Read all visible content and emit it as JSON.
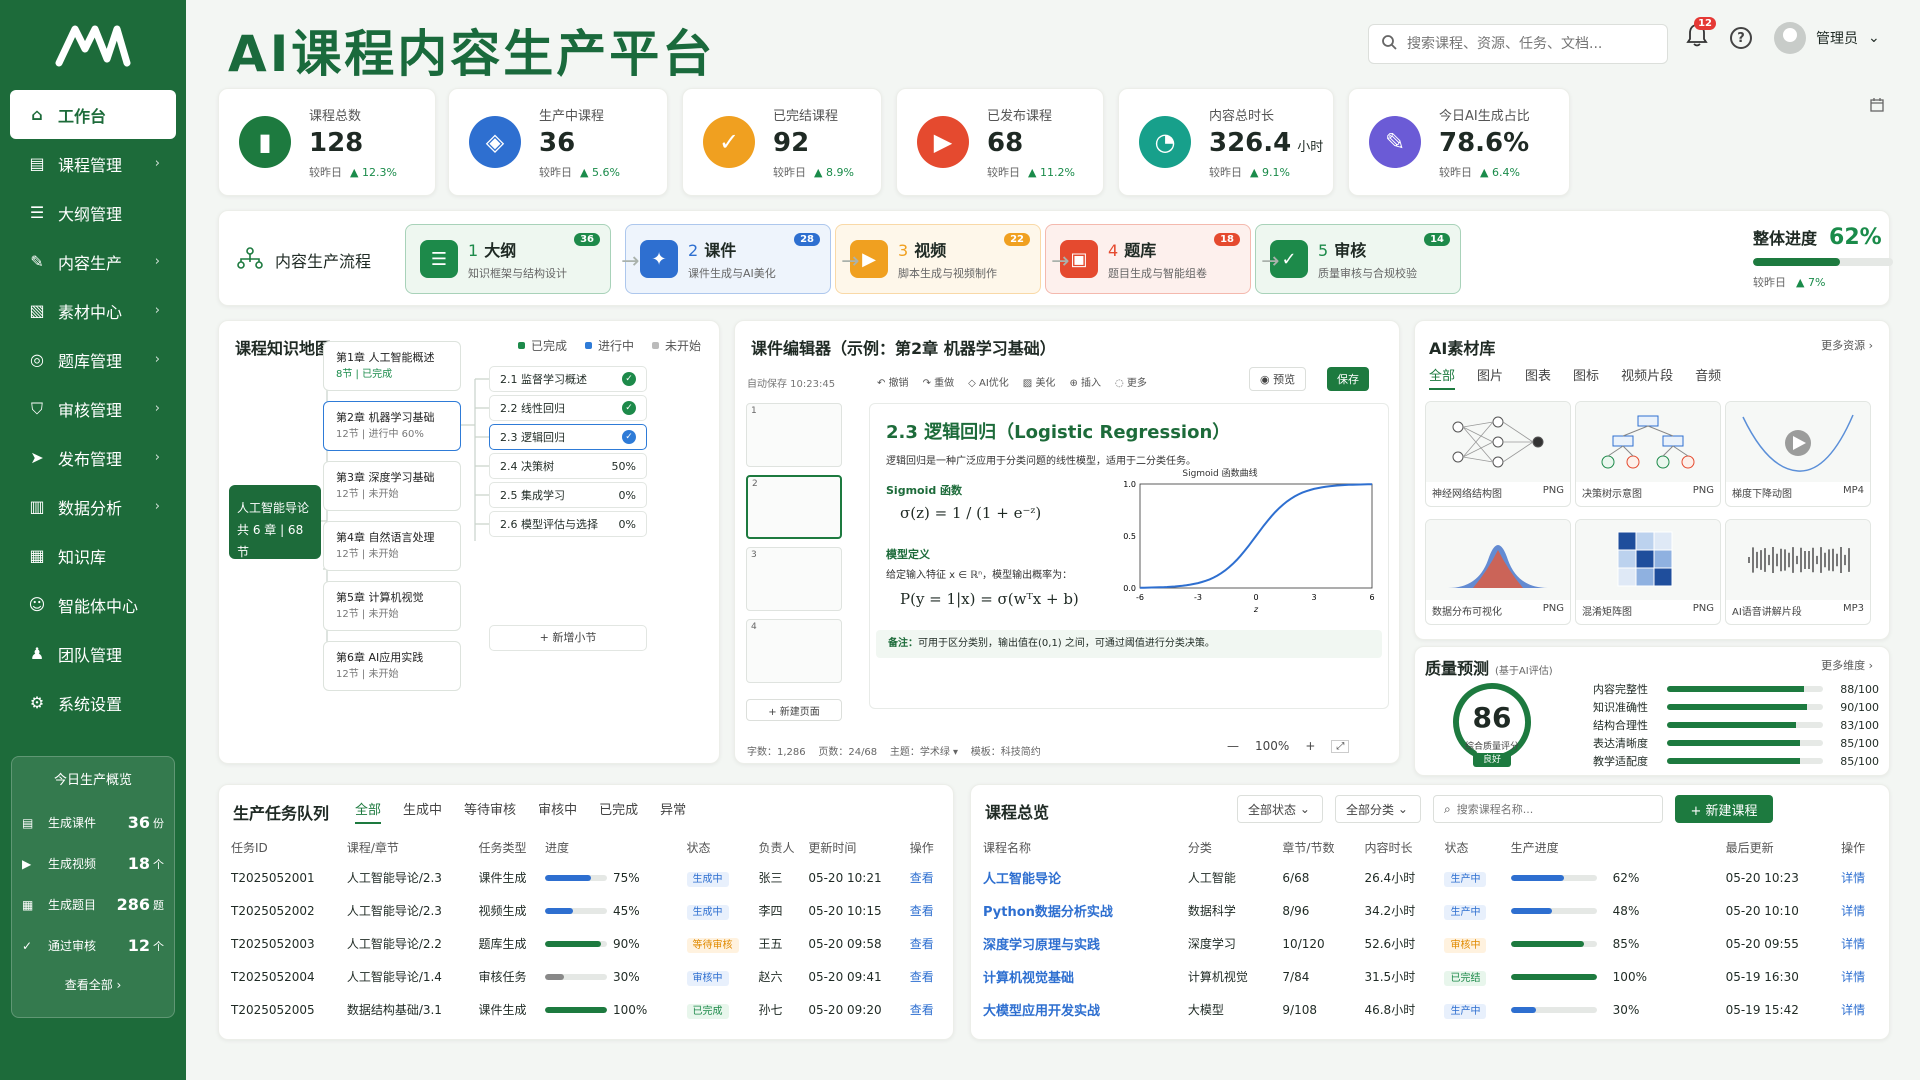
{
  "app": {
    "title": "AI课程内容生产平台",
    "search_placeholder": "搜索课程、资源、任务、文档...",
    "notifications": "12",
    "user": "管理员"
  },
  "sidebar": {
    "items": [
      {
        "label": "工作台",
        "icon": "home-icon"
      },
      {
        "label": "课程管理",
        "icon": "course-icon"
      },
      {
        "label": "大纲管理",
        "icon": "outline-icon"
      },
      {
        "label": "内容生产",
        "icon": "edit-icon"
      },
      {
        "label": "素材中心",
        "icon": "image-icon"
      },
      {
        "label": "题库管理",
        "icon": "quiz-icon"
      },
      {
        "label": "审核管理",
        "icon": "shield-icon"
      },
      {
        "label": "发布管理",
        "icon": "send-icon"
      },
      {
        "label": "数据分析",
        "icon": "chart-icon"
      },
      {
        "label": "知识库",
        "icon": "book-icon"
      },
      {
        "label": "智能体中心",
        "icon": "bot-icon"
      },
      {
        "label": "团队管理",
        "icon": "team-icon"
      },
      {
        "label": "系统设置",
        "icon": "gear-icon"
      }
    ],
    "today": {
      "title": "今日生产概览",
      "rows": [
        {
          "label": "生成课件",
          "value": "36",
          "unit": "份"
        },
        {
          "label": "生成视频",
          "value": "18",
          "unit": "个"
        },
        {
          "label": "生成题目",
          "value": "286",
          "unit": "题"
        },
        {
          "label": "通过审核",
          "value": "12",
          "unit": "个"
        }
      ],
      "more": "查看全部 ›"
    }
  },
  "kpis": [
    {
      "label": "课程总数",
      "value": "128",
      "unit": "",
      "cmp": "较昨日",
      "change": "▲ 12.3%",
      "color": "#1d7a3f"
    },
    {
      "label": "生产中课程",
      "value": "36",
      "unit": "",
      "cmp": "较昨日",
      "change": "▲ 5.6%",
      "color": "#2e6fd0"
    },
    {
      "label": "已完结课程",
      "value": "92",
      "unit": "",
      "cmp": "较昨日",
      "change": "▲ 8.9%",
      "color": "#f0a020"
    },
    {
      "label": "已发布课程",
      "value": "68",
      "unit": "",
      "cmp": "较昨日",
      "change": "▲ 11.2%",
      "color": "#e54a2f"
    },
    {
      "label": "内容总时长",
      "value": "326.4",
      "unit": "小时",
      "cmp": "较昨日",
      "change": "▲ 9.1%",
      "color": "#17a08b"
    },
    {
      "label": "今日AI生成占比",
      "value": "78.6%",
      "unit": "",
      "cmp": "较昨日",
      "change": "▲ 6.4%",
      "color": "#6b5bd6"
    }
  ],
  "flow": {
    "title": "内容生产流程",
    "steps": [
      {
        "num": "1",
        "name": "大纲",
        "desc": "知识框架与结构设计",
        "count": "36",
        "color": "#1d8a4a",
        "bg": "#eef7f0"
      },
      {
        "num": "2",
        "name": "课件",
        "desc": "课件生成与AI美化",
        "count": "28",
        "color": "#2e6fd0",
        "bg": "#eef4fc"
      },
      {
        "num": "3",
        "name": "视频",
        "desc": "脚本生成与视频制作",
        "count": "22",
        "color": "#f0a020",
        "bg": "#fef7ea"
      },
      {
        "num": "4",
        "name": "题库",
        "desc": "题目生成与智能组卷",
        "count": "18",
        "color": "#e54a2f",
        "bg": "#fdf0ed"
      },
      {
        "num": "5",
        "name": "审核",
        "desc": "质量审核与合规校验",
        "count": "14",
        "color": "#1d8a4a",
        "bg": "#eef7f0"
      }
    ],
    "progress_label": "整体进度",
    "progress": "62%",
    "progress_value": 0.62,
    "cmp": "较昨日",
    "change": "▲ 7%"
  },
  "knowledge_map": {
    "title": "课程知识地图",
    "legend": [
      "已完成",
      "进行中",
      "未开始"
    ],
    "root": {
      "name": "人工智能导论",
      "meta": "共 6 章 | 68 节"
    },
    "chapters": [
      {
        "name": "第1章 人工智能概述",
        "meta": "8节 | 已完成"
      },
      {
        "name": "第2章 机器学习基础",
        "meta": "12节 | 进行中 60%"
      },
      {
        "name": "第3章 深度学习基础",
        "meta": "12节 | 未开始"
      },
      {
        "name": "第4章 自然语言处理",
        "meta": "12节 | 未开始"
      },
      {
        "name": "第5章 计算机视觉",
        "meta": "12节 | 未开始"
      },
      {
        "name": "第6章 AI应用实践",
        "meta": "12节 | 未开始"
      }
    ],
    "sections": [
      {
        "name": "2.1 监督学习概述",
        "status": "✓"
      },
      {
        "name": "2.2 线性回归",
        "status": "✓"
      },
      {
        "name": "2.3 逻辑回归",
        "status": "✓"
      },
      {
        "name": "2.4 决策树",
        "status": "50%"
      },
      {
        "name": "2.5 集成学习",
        "status": "0%"
      },
      {
        "name": "2.6 模型评估与选择",
        "status": "0%"
      }
    ],
    "add": "+ 新增小节"
  },
  "editor": {
    "title": "课件编辑器（示例：第2章 机器学习基础）",
    "autosave": "自动保存 10:23:45",
    "tools": [
      "撤销",
      "重做",
      "AI优化",
      "美化",
      "插入",
      "更多"
    ],
    "preview": "预览",
    "save": "保存",
    "slide_title": "2.3 逻辑回归（Logistic Regression）",
    "intro": "逻辑回归是一种广泛应用于分类问题的线性模型，适用于二分类任务。",
    "sigmoid_label": "Sigmoid 函数",
    "formula1": "σ(z) = 1 / (1 + e⁻ᶻ)",
    "def_label": "模型定义",
    "def_text": "给定输入特征 x ∈ ℝⁿ，模型输出概率为：",
    "formula2": "P(y = 1|x) = σ(wᵀx + b)",
    "plot_title": "Sigmoid 函数曲线",
    "plot_xlabel": "z",
    "note_label": "备注：",
    "note": "可用于区分类别，输出值在(0,1) 之间，可通过阈值进行分类决策。",
    "add_page": "+ 新建页面",
    "status": "字数：1,286    页数：24/68    主题：学术绿 ▾    模板：科技简约",
    "zoom": "100%"
  },
  "chart_data": {
    "type": "line",
    "title": "Sigmoid 函数曲线",
    "xlabel": "z",
    "ylabel": "",
    "x": [
      -6,
      -5,
      -4,
      -3,
      -2,
      -1,
      0,
      1,
      2,
      3,
      4,
      5,
      6
    ],
    "y": [
      0.0025,
      0.0067,
      0.018,
      0.047,
      0.119,
      0.269,
      0.5,
      0.731,
      0.881,
      0.953,
      0.982,
      0.993,
      0.9975
    ],
    "xticks": [
      "-6",
      "-3",
      "0",
      "3",
      "6"
    ],
    "yticks": [
      "0.0",
      "0.5",
      "1.0"
    ],
    "xlim": [
      -6,
      6
    ],
    "ylim": [
      0,
      1
    ],
    "color": "#2e6fd0"
  },
  "library": {
    "title": "AI素材库",
    "more": "更多资源 ›",
    "tabs": [
      "全部",
      "图片",
      "图表",
      "图标",
      "视频片段",
      "音频"
    ],
    "assets": [
      {
        "name": "神经网络结构图",
        "type": "PNG"
      },
      {
        "name": "决策树示意图",
        "type": "PNG"
      },
      {
        "name": "梯度下降动图",
        "type": "MP4"
      },
      {
        "name": "数据分布可视化",
        "type": "PNG"
      },
      {
        "name": "混淆矩阵图",
        "type": "PNG"
      },
      {
        "name": "AI语音讲解片段",
        "type": "MP3"
      }
    ]
  },
  "quality": {
    "title": "质量预测",
    "subtitle": "(基于AI评估)",
    "more": "更多维度 ›",
    "score": "86",
    "score_value": 0.86,
    "score_label": "综合质量评分",
    "grade": "良好",
    "metrics": [
      {
        "name": "内容完整性",
        "value": "88/100",
        "v": 0.88
      },
      {
        "name": "知识准确性",
        "value": "90/100",
        "v": 0.9
      },
      {
        "name": "结构合理性",
        "value": "83/100",
        "v": 0.83
      },
      {
        "name": "表达清晰度",
        "value": "85/100",
        "v": 0.85
      },
      {
        "name": "教学适配度",
        "value": "85/100",
        "v": 0.85
      }
    ]
  },
  "tasks": {
    "title": "生产任务队列",
    "tabs": [
      "全部",
      "生成中",
      "等待审核",
      "审核中",
      "已完成",
      "异常"
    ],
    "columns": [
      "任务ID",
      "课程/章节",
      "任务类型",
      "进度",
      "状态",
      "负责人",
      "更新时间",
      "操作"
    ],
    "rows": [
      {
        "id": "T2025052001",
        "course": "人工智能导论/2.3",
        "type": "课件生成",
        "pct": "75%",
        "p": 0.75,
        "status": "生成中",
        "owner": "张三",
        "time": "05-20 10:21",
        "op": "查看"
      },
      {
        "id": "T2025052002",
        "course": "人工智能导论/2.3",
        "type": "视频生成",
        "pct": "45%",
        "p": 0.45,
        "status": "生成中",
        "owner": "李四",
        "time": "05-20 10:15",
        "op": "查看"
      },
      {
        "id": "T2025052003",
        "course": "人工智能导论/2.2",
        "type": "题库生成",
        "pct": "90%",
        "p": 0.9,
        "status": "等待审核",
        "owner": "王五",
        "time": "05-20 09:58",
        "op": "查看"
      },
      {
        "id": "T2025052004",
        "course": "人工智能导论/1.4",
        "type": "审核任务",
        "pct": "30%",
        "p": 0.3,
        "status": "审核中",
        "owner": "赵六",
        "time": "05-20 09:41",
        "op": "查看"
      },
      {
        "id": "T2025052005",
        "course": "数据结构基础/3.1",
        "type": "课件生成",
        "pct": "100%",
        "p": 1.0,
        "status": "已完成",
        "owner": "孙七",
        "time": "05-20 09:20",
        "op": "查看"
      }
    ]
  },
  "courses": {
    "title": "课程总览",
    "filter_status": "全部状态",
    "filter_category": "全部分类",
    "search_placeholder": "搜索课程名称...",
    "new": "+ 新建课程",
    "columns": [
      "课程名称",
      "分类",
      "章节/节数",
      "内容时长",
      "状态",
      "生产进度",
      "最后更新",
      "操作"
    ],
    "rows": [
      {
        "name": "人工智能导论",
        "cat": "人工智能",
        "chapters": "6/68",
        "dur": "26.4小时",
        "status": "生产中",
        "pct": "62%",
        "p": 0.62,
        "time": "05-20 10:23",
        "op": "详情"
      },
      {
        "name": "Python数据分析实战",
        "cat": "数据科学",
        "chapters": "8/96",
        "dur": "34.2小时",
        "status": "生产中",
        "pct": "48%",
        "p": 0.48,
        "time": "05-20 10:10",
        "op": "详情"
      },
      {
        "name": "深度学习原理与实践",
        "cat": "深度学习",
        "chapters": "10/120",
        "dur": "52.6小时",
        "status": "审核中",
        "pct": "85%",
        "p": 0.85,
        "time": "05-20 09:55",
        "op": "详情"
      },
      {
        "name": "计算机视觉基础",
        "cat": "计算机视觉",
        "chapters": "7/84",
        "dur": "31.5小时",
        "status": "已完结",
        "pct": "100%",
        "p": 1.0,
        "time": "05-19 16:30",
        "op": "详情"
      },
      {
        "name": "大模型应用开发实战",
        "cat": "大模型",
        "chapters": "9/108",
        "dur": "46.8小时",
        "status": "生产中",
        "pct": "30%",
        "p": 0.3,
        "time": "05-19 15:42",
        "op": "详情"
      }
    ]
  }
}
